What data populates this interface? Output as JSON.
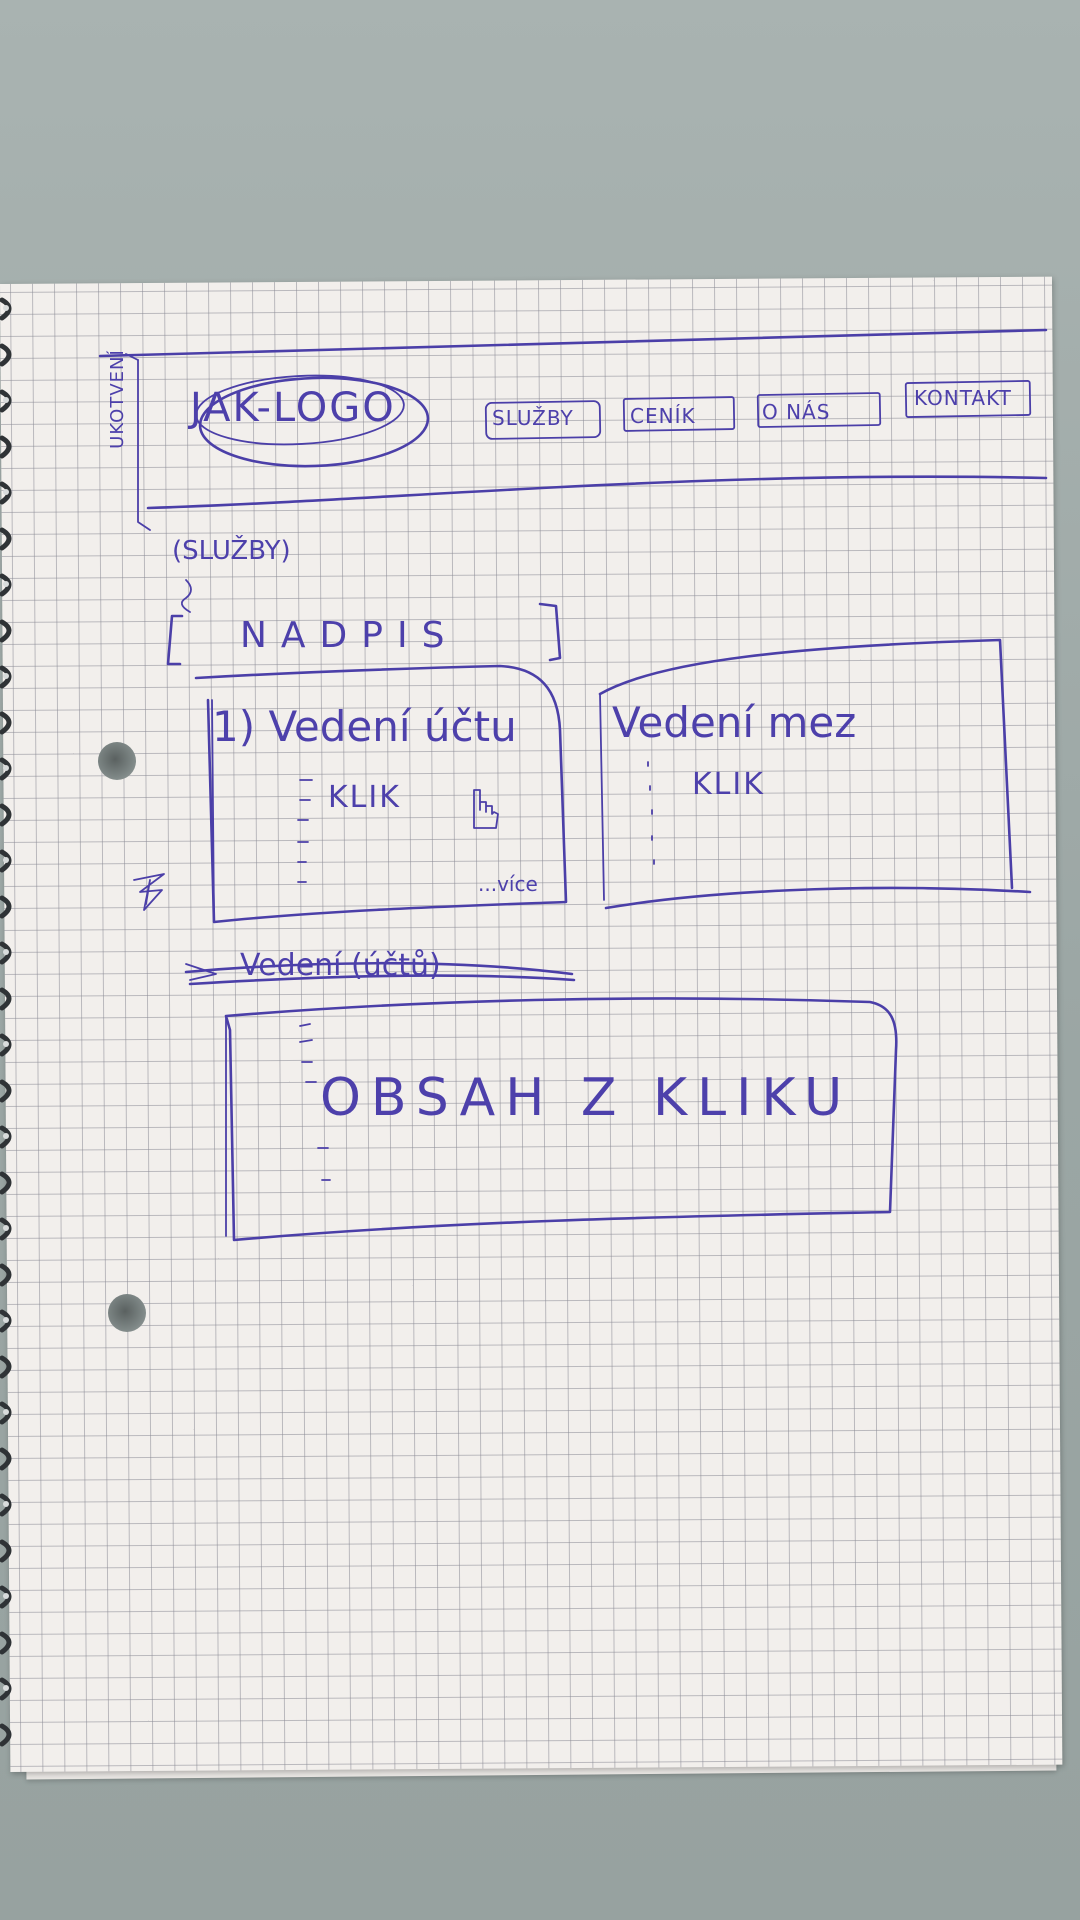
{
  "sketch": {
    "side_note": "UKOTVENÍ",
    "logo": "JAK-LOGO",
    "nav": [
      "SLUŽBY",
      "CENÍK",
      "O NÁS",
      "KONTAKT"
    ],
    "section_name": "(SLUŽBY)",
    "heading": "NADPIS",
    "cards": [
      {
        "title": "1) Vedení účtu",
        "action": "KLIK",
        "more": "...více"
      },
      {
        "title": "Vedení mez",
        "action": "KLIK"
      }
    ],
    "crossed_out": "Vedení (účtů)",
    "content_box": "OBSAH Z KLIKU"
  },
  "colors": {
    "ink": "#4b3fa8",
    "paper": "#f2efec",
    "grid": "#8c8c96",
    "table": "#a3adab"
  }
}
